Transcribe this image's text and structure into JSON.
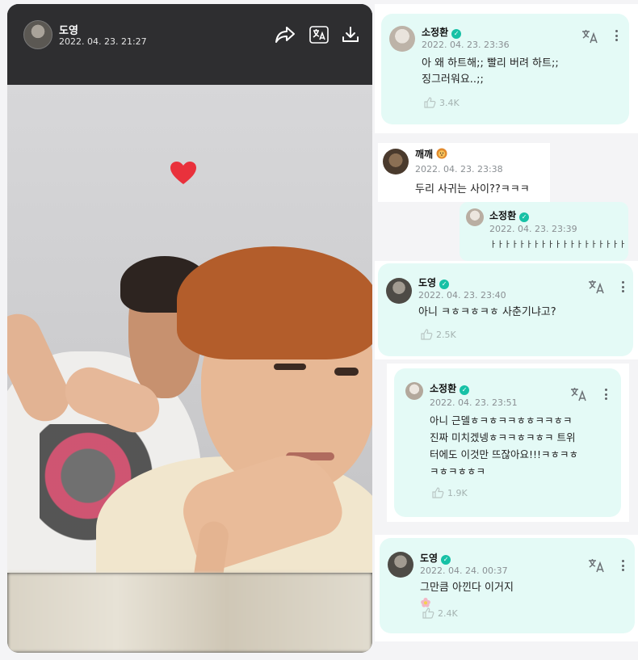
{
  "post": {
    "author": "도영",
    "date": "2022. 04. 23. 21:27",
    "icons": [
      "share-icon",
      "translate-icon",
      "download-icon"
    ]
  },
  "comments": [
    {
      "name": "소정환",
      "verified": true,
      "date": "2022. 04. 23. 23:36",
      "text": "아 왜 하트해;; 빨리 버려 하트;;\n징그러워요..;;",
      "likes": "3.4K"
    },
    {
      "name": "깨깨",
      "emoji": "lion-emoji",
      "verified": false,
      "date": "2022. 04. 23. 23:38",
      "text": "두리 사귀는 사이??ㅋㅋㅋ"
    },
    {
      "name": "소정환",
      "verified": true,
      "date": "2022. 04. 23. 23:39",
      "text": "ㅏㅏㅏㅏㅏㅏㅏㅏㅏㅏㅏㅏㅏㅏㅏㅏㅏㅏㅏㅏㅏㅏ"
    },
    {
      "name": "도영",
      "verified": true,
      "date": "2022. 04. 23. 23:40",
      "text": "아니 ㅋㅎㅋㅎㅋㅎ 사춘기냐고?",
      "likes": "2.5K"
    },
    {
      "name": "소정환",
      "verified": true,
      "date": "2022. 04. 23. 23:51",
      "text": "아니 근델ㅎㅋㅎㅋㅋㅎㅎㅋㅋㅎㅋ\n진짜 미치겠넹ㅎㅋㅋㅎㅋㅎㅋ 트위\n터에도 이것만 뜨잖아요!!!ㅋㅎㅋㅎ\nㅋㅎㅋㅎㅎㅋ",
      "likes": "1.9K"
    },
    {
      "name": "도영",
      "verified": true,
      "date": "2022. 04. 24. 00:37",
      "text": "그만큼 아낀다 이거지",
      "emoji": "flower-emoji",
      "likes": "2.4K"
    }
  ],
  "colors": {
    "card": "#e4faf6",
    "verified": "#17c1a6",
    "heart": "#e9313c"
  }
}
